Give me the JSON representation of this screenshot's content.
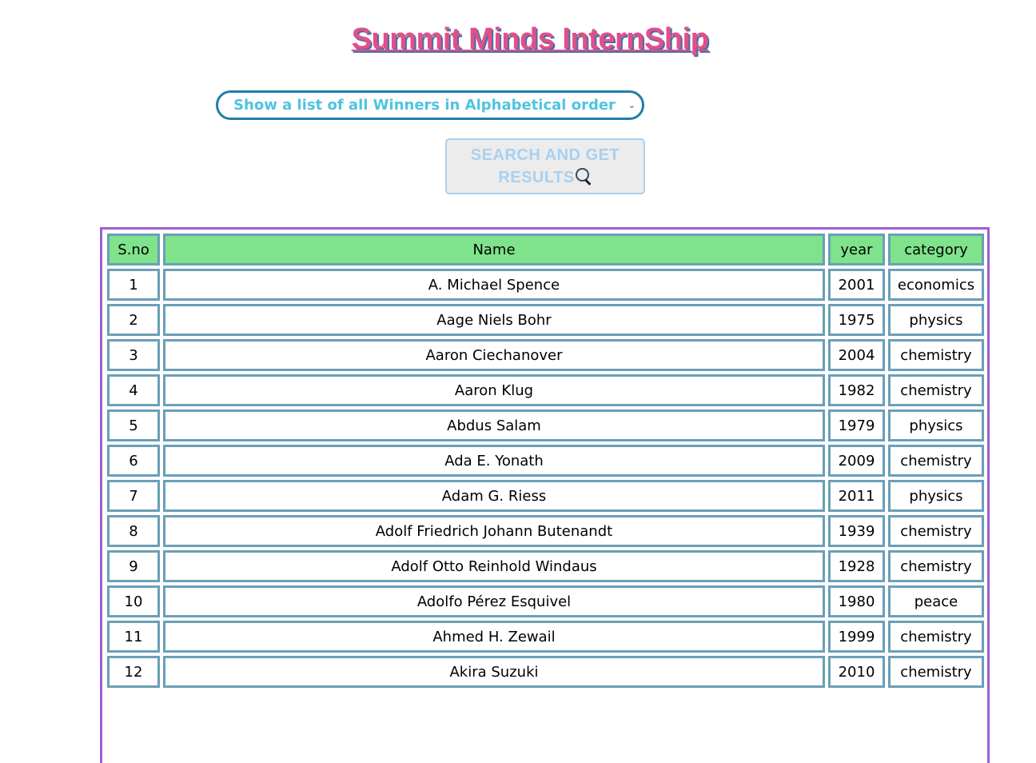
{
  "header": {
    "title": "Summit Minds InternShip"
  },
  "query_select": {
    "selected": "Show a list of all Winners in Alphabetical order"
  },
  "search_button": {
    "label": "SEARCH AND GET RESULTS"
  },
  "table": {
    "columns": [
      "S.no",
      "Name",
      "year",
      "category"
    ],
    "rows": [
      {
        "sno": "1",
        "name": "A. Michael Spence",
        "year": "2001",
        "category": "economics"
      },
      {
        "sno": "2",
        "name": "Aage Niels Bohr",
        "year": "1975",
        "category": "physics"
      },
      {
        "sno": "3",
        "name": "Aaron Ciechanover",
        "year": "2004",
        "category": "chemistry"
      },
      {
        "sno": "4",
        "name": "Aaron Klug",
        "year": "1982",
        "category": "chemistry"
      },
      {
        "sno": "5",
        "name": "Abdus Salam",
        "year": "1979",
        "category": "physics"
      },
      {
        "sno": "6",
        "name": "Ada E. Yonath",
        "year": "2009",
        "category": "chemistry"
      },
      {
        "sno": "7",
        "name": "Adam G. Riess",
        "year": "2011",
        "category": "physics"
      },
      {
        "sno": "8",
        "name": "Adolf Friedrich Johann Butenandt",
        "year": "1939",
        "category": "chemistry"
      },
      {
        "sno": "9",
        "name": "Adolf Otto Reinhold Windaus",
        "year": "1928",
        "category": "chemistry"
      },
      {
        "sno": "10",
        "name": "Adolfo Pérez Esquivel",
        "year": "1980",
        "category": "peace"
      },
      {
        "sno": "11",
        "name": "Ahmed H. Zewail",
        "year": "1999",
        "category": "chemistry"
      },
      {
        "sno": "12",
        "name": "Akira Suzuki",
        "year": "2010",
        "category": "chemistry"
      }
    ]
  },
  "colors": {
    "title": "#e0508a",
    "title_shadow": "#4a6fa5",
    "select_border": "#1f7fa8",
    "select_text": "#4fc3e0",
    "header_bg": "#7ee38a",
    "cell_border": "#6a9fb8",
    "frame_border": "#9f5fcf"
  }
}
